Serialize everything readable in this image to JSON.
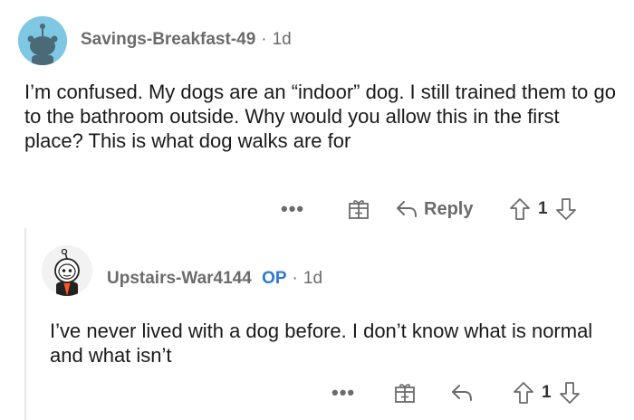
{
  "comment": {
    "username": "Savings-Breakfast-49",
    "separator": "·",
    "age": "1d",
    "body": "I’m confused. My dogs are an “indoor” dog. I still trained them to go to the bathroom outside. Why would you allow this in the first place? This is what dog walks are for",
    "actions": {
      "more_label": "•••",
      "reply_label": "Reply",
      "vote_count": "1"
    }
  },
  "reply": {
    "username": "Upstairs-War4144",
    "op_badge": "OP",
    "separator": "·",
    "age": "1d",
    "body": "I’ve never lived with a dog before. I don’t know what is normal and what isn’t",
    "actions": {
      "more_label": "•••",
      "vote_count": "1"
    }
  },
  "icons": {
    "more": "more-dots-icon",
    "award": "gift-icon",
    "reply": "reply-arrow-icon",
    "upvote": "upvote-arrow-icon",
    "downvote": "downvote-arrow-icon",
    "avatar_main": "snoo-avatar",
    "avatar_reply": "astronaut-snoo-avatar"
  },
  "colors": {
    "op_badge": "#2b7bd1",
    "meta_text": "#6b6b6b",
    "avatar_main_bg": "#7ec8e3"
  }
}
